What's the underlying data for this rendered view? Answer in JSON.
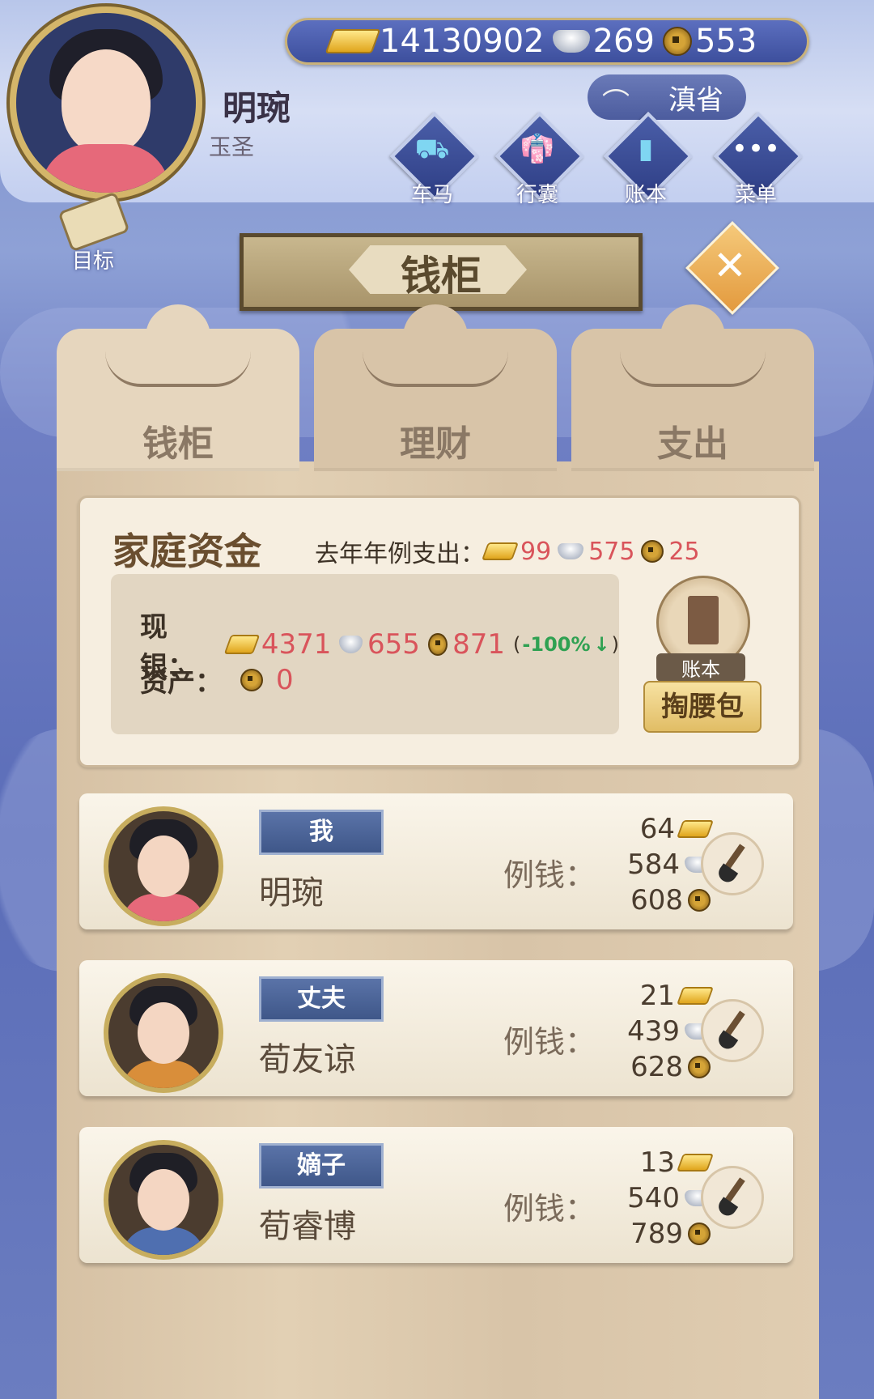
{
  "player": {
    "name": "明琬",
    "title": "玉圣"
  },
  "currency": {
    "gold": "14130902",
    "silver": "269",
    "copper": "553"
  },
  "region": {
    "label": "滇省"
  },
  "nav": [
    {
      "label": "车马",
      "glyph": "⛟"
    },
    {
      "label": "行囊",
      "glyph": "👘"
    },
    {
      "label": "账本",
      "glyph": "▮"
    },
    {
      "label": "菜单",
      "glyph": "•••"
    }
  ],
  "goal": {
    "label": "目标"
  },
  "banner": {
    "title": "钱柜"
  },
  "tabs": [
    {
      "label": "钱柜",
      "active": true
    },
    {
      "label": "理财",
      "active": false
    },
    {
      "label": "支出",
      "active": false
    }
  ],
  "funds": {
    "title": "家庭资金",
    "last_year_label": "去年年例支出：",
    "last_year": {
      "gold": "99",
      "silver": "575",
      "copper": "25"
    },
    "cash_label": "现银：",
    "cash": {
      "gold": "4371",
      "silver": "655",
      "copper": "871"
    },
    "change_prefix": "(",
    "change": "-100%",
    "change_arrow": "↓",
    "change_suffix": ")",
    "assets_label": "资产：",
    "assets_value": "0",
    "book_label": "账本",
    "pocket_label": "掏腰包"
  },
  "allowance_label": "例钱：",
  "members": [
    {
      "role": "我",
      "name": "明琬",
      "gold": "64",
      "silver": "584",
      "copper": "608",
      "robe_color": "#e6697a"
    },
    {
      "role": "丈夫",
      "name": "荀友谅",
      "gold": "21",
      "silver": "439",
      "copper": "628",
      "robe_color": "#d98e3a"
    },
    {
      "role": "嫡子",
      "name": "荀睿博",
      "gold": "13",
      "silver": "540",
      "copper": "789",
      "robe_color": "#4f6fb0"
    }
  ]
}
